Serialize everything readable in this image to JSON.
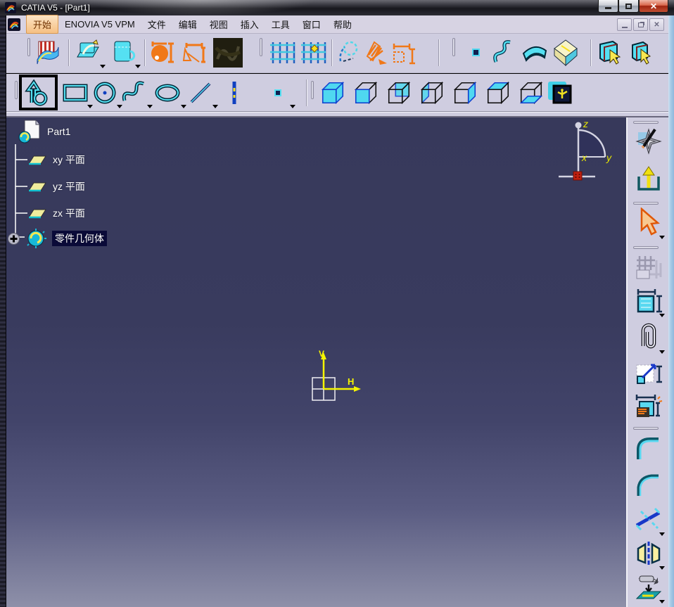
{
  "window": {
    "title": "CATIA V5 - [Part1]",
    "controls": [
      "minimize",
      "maximize",
      "close"
    ]
  },
  "menu": {
    "items": [
      "开始",
      "ENOVIA V5 VPM",
      "文件",
      "编辑",
      "视图",
      "插入",
      "工具",
      "窗口",
      "帮助"
    ],
    "active_item": "开始",
    "mdi_controls": [
      "minimize",
      "restore",
      "close"
    ]
  },
  "toolbars": {
    "standard_row": [
      "surface-flag-icon",
      "sketch-icon",
      "positioned-sketch-icon",
      "circle-constraint-icon",
      "dimension-frame-icon",
      "texture-icon",
      "grid-icon",
      "grid-point-icon",
      "sketch-analysis-icon",
      "cut-plane-icon",
      "dimensions-icon",
      "point-dot-icon",
      "spline-curve-icon",
      "surface-patch-icon",
      "bounding-box-icon",
      "catalog-browser-icon",
      "catalog-browser-2-icon"
    ],
    "sketch_row": [
      "profile-icon",
      "rectangle-icon",
      "circle-icon",
      "spline-icon",
      "ellipse-icon",
      "line-icon",
      "axis-icon",
      "point-icon"
    ],
    "selected_tool": "profile-icon",
    "view_row": [
      "isometric-view-icon",
      "front-view-icon",
      "back-view-icon",
      "left-view-icon",
      "right-view-icon",
      "top-view-icon",
      "bottom-view-icon",
      "named-views-icon"
    ]
  },
  "tree": {
    "root": "Part1",
    "planes": [
      "xy 平面",
      "yz 平面",
      "zx 平面"
    ],
    "body": "零件几何体",
    "selected": "零件几何体"
  },
  "viewport": {
    "compass": {
      "z": "z",
      "y": "y",
      "x": "x"
    },
    "origin": {
      "vertical": "V",
      "horizontal": "H"
    }
  },
  "right_toolbar": {
    "icons": [
      "sketcher-workbench-icon",
      "exit-workbench-icon",
      "select-arrow-icon",
      "sketch-tools-icon",
      "constraint-dialog-icon",
      "constraint-clip-icon",
      "dimension-constraint-icon",
      "auto-constraint-icon",
      "corner-icon",
      "chamfer-icon",
      "trim-icon",
      "mirror-icon",
      "project-3d-icon"
    ]
  },
  "colors": {
    "accent_cyan": "#3fd9f2",
    "accent_orange": "#f07818",
    "toolbar_bg": "#cfcde0",
    "viewport_top": "#37395b",
    "viewport_bottom": "#8e90a9",
    "axis_yellow": "#f5f500",
    "close_red": "#c24f33",
    "selection_border": "#000000"
  }
}
